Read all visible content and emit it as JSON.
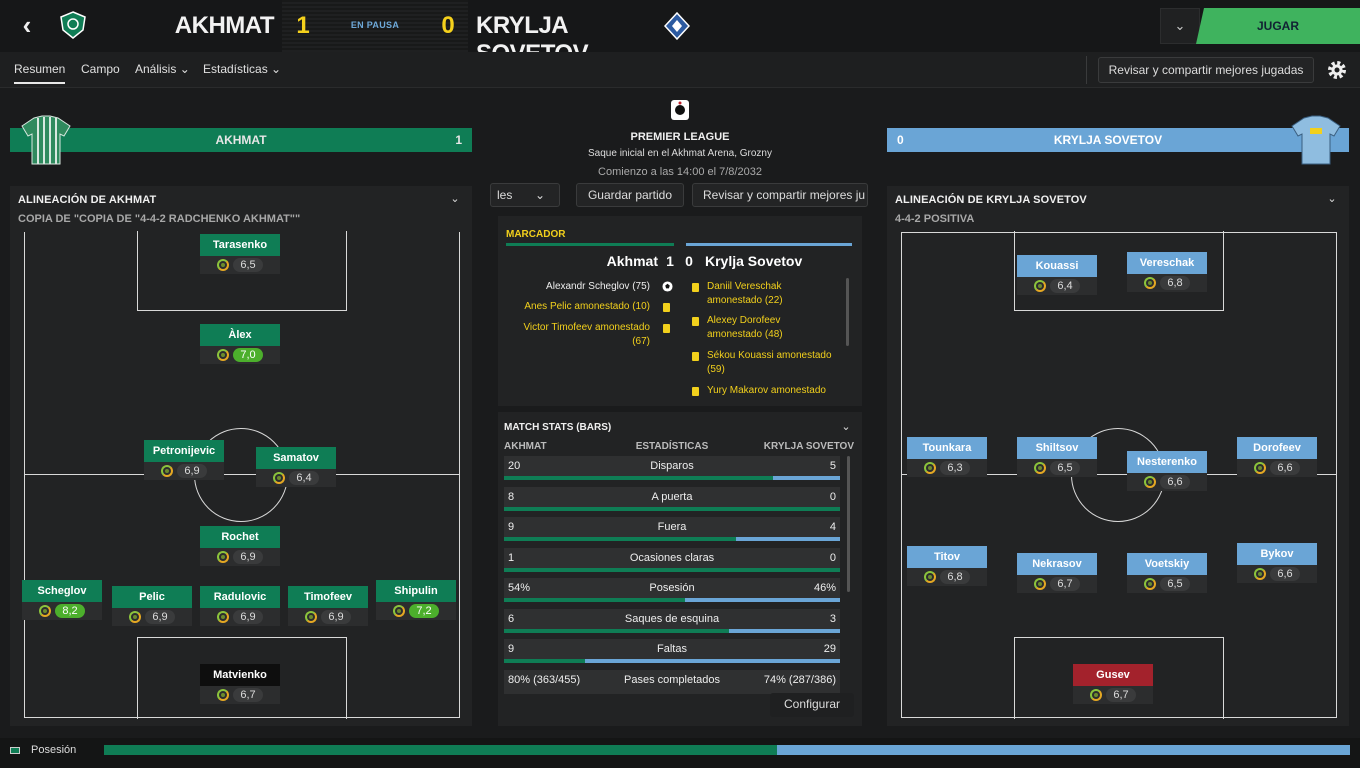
{
  "header": {
    "home_team": "AKHMAT",
    "home_score": "1",
    "status": "EN PAUSA",
    "away_score": "0",
    "away_team": "KRYLJA SOVETOV",
    "play_button": "JUGAR",
    "dropdown_icon": "chevron-down-icon"
  },
  "nav": {
    "tabs": [
      "Resumen",
      "Campo",
      "Análisis",
      "Estadísticas"
    ],
    "share_button": "Revisar y compartir mejores jugadas"
  },
  "colors": {
    "home": "#0f7d55",
    "away": "#6aa5d6",
    "accent": "#3fb35e",
    "card": "#f2d01c"
  },
  "home_bar": {
    "name": "AKHMAT",
    "count": "1"
  },
  "away_bar": {
    "name": "KRYLJA SOVETOV",
    "count": "0"
  },
  "match_info": {
    "competition": "PREMIER LEAGUE",
    "venue": "Saque inicial en el Akhmat Arena, Grozny",
    "kickoff": "Comienzo a las 14:00 el 7/8/2032"
  },
  "center_toolbar": {
    "partial_left": "les",
    "save": "Guardar partido",
    "share": "Revisar y compartir mejores ju"
  },
  "home_lineup": {
    "title": "ALINEACIÓN DE AKHMAT",
    "formation": "COPIA DE \"COPIA DE \"4-4-2 RADCHENKO AKHMAT\"\"",
    "players": [
      {
        "name": "Tarasenko",
        "rating": "6,5",
        "color": "green"
      },
      {
        "name": "Àlex",
        "rating": "7,0",
        "color": "green",
        "high": true
      },
      {
        "name": "Petronijevic",
        "rating": "6,9",
        "color": "green"
      },
      {
        "name": "Samatov",
        "rating": "6,4",
        "color": "green"
      },
      {
        "name": "Rochet",
        "rating": "6,9",
        "color": "green"
      },
      {
        "name": "Scheglov",
        "rating": "8,2",
        "color": "green",
        "high": true
      },
      {
        "name": "Pelic",
        "rating": "6,9",
        "color": "green"
      },
      {
        "name": "Radulovic",
        "rating": "6,9",
        "color": "green"
      },
      {
        "name": "Timofeev",
        "rating": "6,9",
        "color": "green"
      },
      {
        "name": "Shipulin",
        "rating": "7,2",
        "color": "green",
        "high": true
      },
      {
        "name": "Matvienko",
        "rating": "6,7",
        "color": "dark"
      }
    ]
  },
  "away_lineup": {
    "title": "ALINEACIÓN DE KRYLJA SOVETOV",
    "formation": "4-4-2 POSITIVA",
    "players": [
      {
        "name": "Kouassi",
        "rating": "6,4",
        "color": "blue"
      },
      {
        "name": "Vereschak",
        "rating": "6,8",
        "color": "blue"
      },
      {
        "name": "Tounkara",
        "rating": "6,3",
        "color": "blue"
      },
      {
        "name": "Shiltsov",
        "rating": "6,5",
        "color": "blue"
      },
      {
        "name": "Nesterenko",
        "rating": "6,6",
        "color": "blue"
      },
      {
        "name": "Dorofeev",
        "rating": "6,6",
        "color": "blue"
      },
      {
        "name": "Titov",
        "rating": "6,8",
        "color": "blue"
      },
      {
        "name": "Nekrasov",
        "rating": "6,7",
        "color": "blue"
      },
      {
        "name": "Voetskiy",
        "rating": "6,5",
        "color": "blue"
      },
      {
        "name": "Bykov",
        "rating": "6,6",
        "color": "blue"
      },
      {
        "name": "Gusev",
        "rating": "6,7",
        "color": "red"
      }
    ]
  },
  "scoreboard": {
    "title": "MARCADOR",
    "home": "Akhmat",
    "home_score": "1",
    "away_score": "0",
    "away": "Krylja Sovetov",
    "home_events": [
      {
        "text": "Alexandr Scheglov (75)",
        "icon": "ball-icon"
      },
      {
        "text": "Anes Pelic amonestado (10)",
        "icon": "yellow-card-icon"
      },
      {
        "text": "Victor Timofeev amonestado",
        "text2": "(67)",
        "icon": "yellow-card-icon"
      }
    ],
    "away_events": [
      {
        "text": "Daniil Vereschak",
        "text2": "amonestado (22)"
      },
      {
        "text": "Alexey Dorofeev",
        "text2": "amonestado (48)"
      },
      {
        "text": "Sékou Kouassi amonestado",
        "text2": "(59)"
      },
      {
        "text": "Yury Makarov amonestado",
        "text2": ""
      }
    ]
  },
  "stats": {
    "title": "MATCH STATS (BARS)",
    "col_home": "AKHMAT",
    "col_mid": "ESTADÍSTICAS",
    "col_away": "KRYLJA SOVETOV",
    "rows": [
      {
        "home": "20",
        "label": "Disparos",
        "away": "5",
        "home_share": 0.8
      },
      {
        "home": "8",
        "label": "A puerta",
        "away": "0",
        "home_share": 1.0
      },
      {
        "home": "9",
        "label": "Fuera",
        "away": "4",
        "home_share": 0.69
      },
      {
        "home": "1",
        "label": "Ocasiones claras",
        "away": "0",
        "home_share": 1.0
      },
      {
        "home": "54%",
        "label": "Posesión",
        "away": "46%",
        "home_share": 0.54
      },
      {
        "home": "6",
        "label": "Saques de esquina",
        "away": "3",
        "home_share": 0.67
      },
      {
        "home": "9",
        "label": "Faltas",
        "away": "29",
        "home_share": 0.24
      },
      {
        "home": "80% (363/455)",
        "label": "Pases completados",
        "away": "74% (287/386)"
      }
    ],
    "configure": "Configurar"
  },
  "footer": {
    "label": "Posesión",
    "home_share": 0.54
  }
}
